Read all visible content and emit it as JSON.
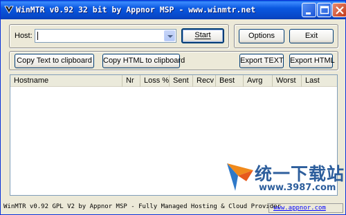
{
  "window": {
    "title": "WinMTR v0.92 32 bit by Appnor MSP - www.winmtr.net"
  },
  "controls": {
    "host_label": "Host:",
    "host_value": "",
    "start_button": "Start",
    "options_button": "Options",
    "exit_button": "Exit",
    "copy_text_button": "Copy Text to clipboard",
    "copy_html_button": "Copy HTML to clipboard",
    "export_text_button": "Export TEXT",
    "export_html_button": "Export HTML"
  },
  "table": {
    "columns": [
      "Hostname",
      "Nr",
      "Loss %",
      "Sent",
      "Recv",
      "Best",
      "Avrg",
      "Worst",
      "Last"
    ],
    "rows": []
  },
  "watermark": {
    "text": "统一下载站",
    "url": "www.3987.com"
  },
  "statusbar": {
    "text": "WinMTR v0.92 GPL V2 by Appnor MSP - Fully Managed Hosting & Cloud Provider",
    "link": "www.appnor.com"
  },
  "colors": {
    "titlebar": "#0a58e0",
    "face": "#ece9d8",
    "link": "#0000ff",
    "watermark": "#2d5e9c"
  }
}
